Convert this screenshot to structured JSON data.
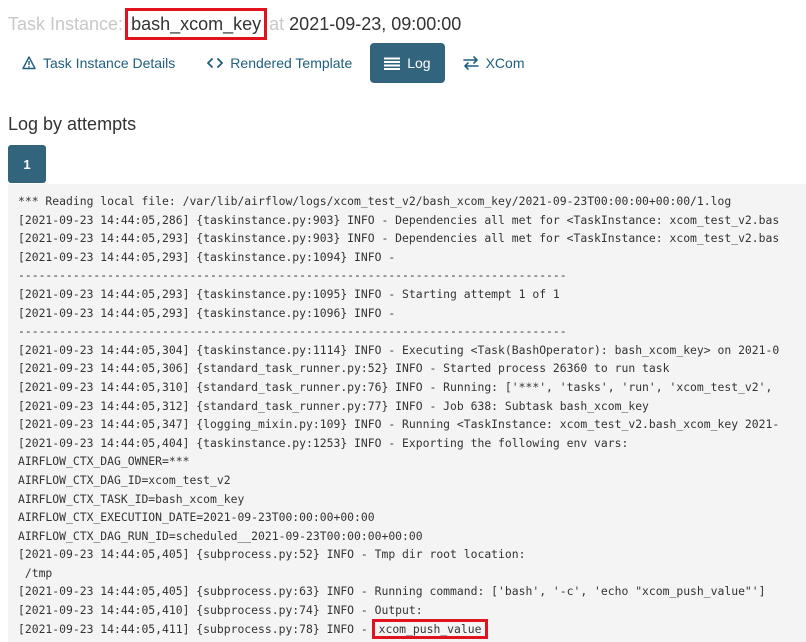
{
  "title": {
    "prefix": "Task Instance:",
    "task_id": "bash_xcom_key",
    "at": "at",
    "execution_date": "2021-09-23, 09:00:00"
  },
  "tabs": [
    {
      "label": "Task Instance Details",
      "icon": "warning-triangle-icon"
    },
    {
      "label": "Rendered Template",
      "icon": "code-icon"
    },
    {
      "label": "Log",
      "icon": "list-icon",
      "active": true
    },
    {
      "label": "XCom",
      "icon": "exchange-arrows-icon"
    }
  ],
  "section_title": "Log by attempts",
  "attempts": [
    "1"
  ],
  "log_lines": [
    "*** Reading local file: /var/lib/airflow/logs/xcom_test_v2/bash_xcom_key/2021-09-23T00:00:00+00:00/1.log",
    "[2021-09-23 14:44:05,286] {taskinstance.py:903} INFO - Dependencies all met for <TaskInstance: xcom_test_v2.bas",
    "[2021-09-23 14:44:05,293] {taskinstance.py:903} INFO - Dependencies all met for <TaskInstance: xcom_test_v2.bas",
    "[2021-09-23 14:44:05,293] {taskinstance.py:1094} INFO -",
    "--------------------------------------------------------------------------------",
    "[2021-09-23 14:44:05,293] {taskinstance.py:1095} INFO - Starting attempt 1 of 1",
    "[2021-09-23 14:44:05,293] {taskinstance.py:1096} INFO -",
    "--------------------------------------------------------------------------------",
    "[2021-09-23 14:44:05,304] {taskinstance.py:1114} INFO - Executing <Task(BashOperator): bash_xcom_key> on 2021-0",
    "[2021-09-23 14:44:05,306] {standard_task_runner.py:52} INFO - Started process 26360 to run task",
    "[2021-09-23 14:44:05,310] {standard_task_runner.py:76} INFO - Running: ['***', 'tasks', 'run', 'xcom_test_v2',",
    "[2021-09-23 14:44:05,312] {standard_task_runner.py:77} INFO - Job 638: Subtask bash_xcom_key",
    "[2021-09-23 14:44:05,347] {logging_mixin.py:109} INFO - Running <TaskInstance: xcom_test_v2.bash_xcom_key 2021-",
    "[2021-09-23 14:44:05,404] {taskinstance.py:1253} INFO - Exporting the following env vars:",
    "AIRFLOW_CTX_DAG_OWNER=***",
    "AIRFLOW_CTX_DAG_ID=xcom_test_v2",
    "AIRFLOW_CTX_TASK_ID=bash_xcom_key",
    "AIRFLOW_CTX_EXECUTION_DATE=2021-09-23T00:00:00+00:00",
    "AIRFLOW_CTX_DAG_RUN_ID=scheduled__2021-09-23T00:00:00+00:00",
    "[2021-09-23 14:44:05,405] {subprocess.py:52} INFO - Tmp dir root location:",
    " /tmp",
    "[2021-09-23 14:44:05,405] {subprocess.py:63} INFO - Running command: ['bash', '-c', 'echo \"xcom_push_value\"']",
    "[2021-09-23 14:44:05,410] {subprocess.py:74} INFO - Output:"
  ],
  "last_line": {
    "prefix": "[2021-09-23 14:44:05,411] {subprocess.py:78} INFO - ",
    "value": "xcom_push_value"
  }
}
